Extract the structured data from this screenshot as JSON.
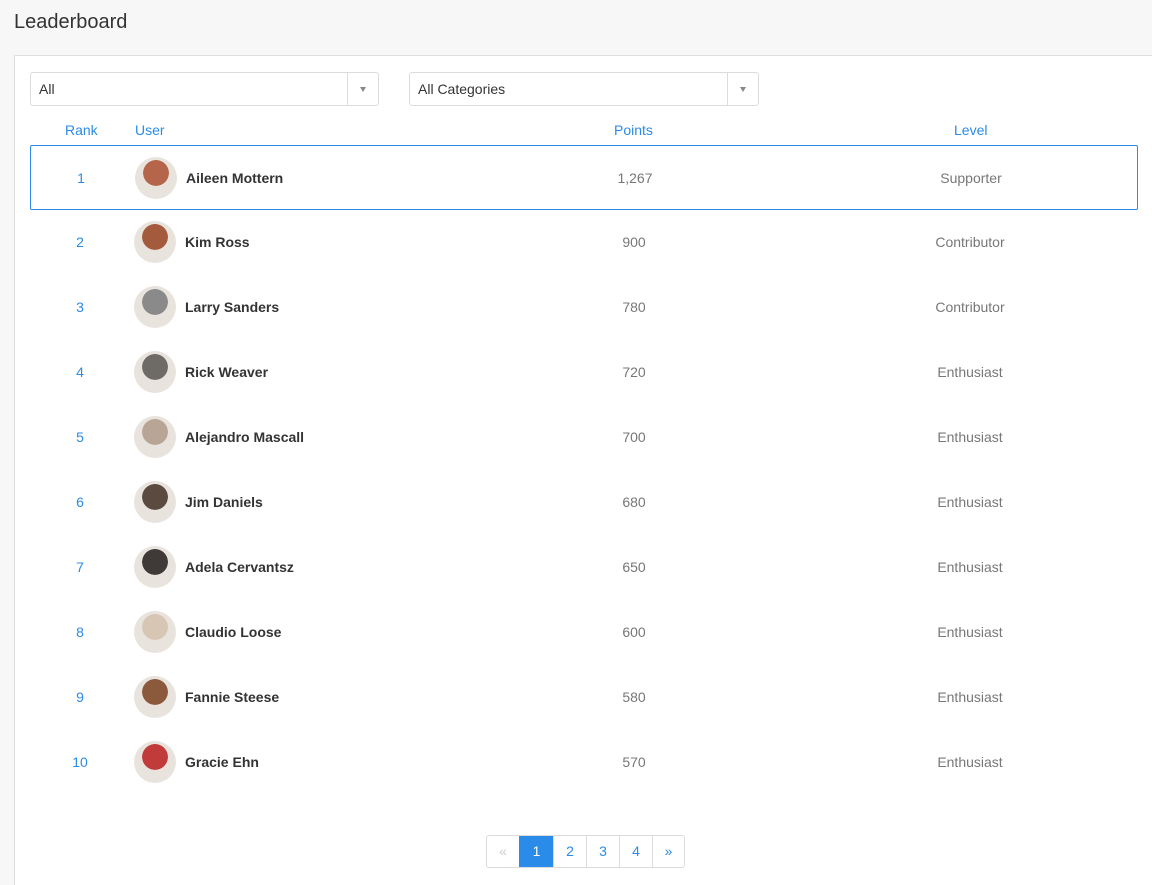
{
  "header": {
    "title": "Leaderboard"
  },
  "filters": {
    "period": {
      "value": "All"
    },
    "category": {
      "value": "All Categories"
    }
  },
  "table": {
    "columns": {
      "rank": "Rank",
      "user": "User",
      "points": "Points",
      "level": "Level"
    },
    "rows": [
      {
        "rank": "1",
        "name": "Aileen Mottern",
        "points": "1,267",
        "level": "Supporter",
        "avatar_color": "#b5654a"
      },
      {
        "rank": "2",
        "name": "Kim Ross",
        "points": "900",
        "level": "Contributor",
        "avatar_color": "#a45a3c"
      },
      {
        "rank": "3",
        "name": "Larry Sanders",
        "points": "780",
        "level": "Contributor",
        "avatar_color": "#8a8a8a"
      },
      {
        "rank": "4",
        "name": "Rick Weaver",
        "points": "720",
        "level": "Enthusiast",
        "avatar_color": "#6e6a66"
      },
      {
        "rank": "5",
        "name": "Alejandro Mascall",
        "points": "700",
        "level": "Enthusiast",
        "avatar_color": "#b9a596"
      },
      {
        "rank": "6",
        "name": "Jim Daniels",
        "points": "680",
        "level": "Enthusiast",
        "avatar_color": "#5b4a40"
      },
      {
        "rank": "7",
        "name": "Adela Cervantsz",
        "points": "650",
        "level": "Enthusiast",
        "avatar_color": "#3f3a38"
      },
      {
        "rank": "8",
        "name": "Claudio Loose",
        "points": "600",
        "level": "Enthusiast",
        "avatar_color": "#d7c6b4"
      },
      {
        "rank": "9",
        "name": "Fannie Steese",
        "points": "580",
        "level": "Enthusiast",
        "avatar_color": "#8b5a3c"
      },
      {
        "rank": "10",
        "name": "Gracie Ehn",
        "points": "570",
        "level": "Enthusiast",
        "avatar_color": "#c23b3b"
      }
    ]
  },
  "pagination": {
    "prev": "«",
    "pages": [
      "1",
      "2",
      "3",
      "4"
    ],
    "next": "»",
    "current": "1"
  },
  "colors": {
    "accent": "#2a8be8",
    "muted": "#777777",
    "border": "#dcdcdc"
  }
}
